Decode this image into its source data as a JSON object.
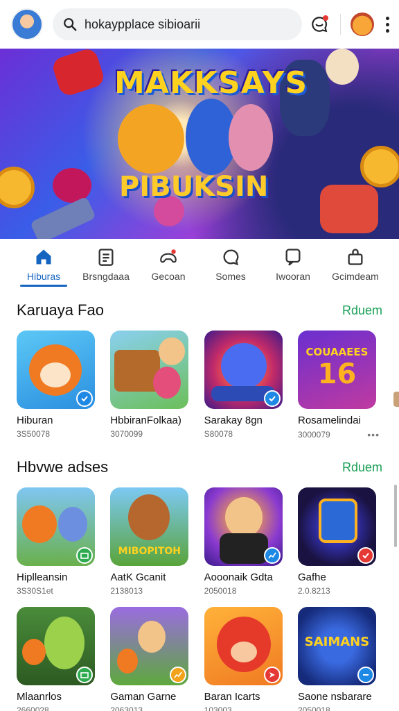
{
  "header": {
    "search_text": "hokaypplace  sibioarii"
  },
  "hero": {
    "title": "MAKKSAYS",
    "subtitle": "PIBUKSIN"
  },
  "tabs": [
    {
      "label": "Hiburas",
      "icon": "home-icon",
      "active": true
    },
    {
      "label": "Brsngdaaa",
      "icon": "clipboard-icon",
      "active": false
    },
    {
      "label": "Gecoan",
      "icon": "controller-icon",
      "active": false
    },
    {
      "label": "Somes",
      "icon": "chat-icon",
      "active": false
    },
    {
      "label": "Iwooran",
      "icon": "message-icon",
      "active": false
    },
    {
      "label": "Gcimdeam",
      "icon": "bag-icon",
      "active": false
    }
  ],
  "sections": [
    {
      "title": "Karuaya Fao",
      "link": "Rduem",
      "cards": [
        {
          "title": "Hiburan",
          "meta": "3S50078",
          "badge_color": "#1e88e5",
          "badge_icon": "check-icon"
        },
        {
          "title": "HbbiranFolkaa)",
          "meta": "3070099",
          "badge_color": "",
          "badge_icon": ""
        },
        {
          "title": "Sarakay 8gn",
          "meta": "S80078",
          "badge_color": "#1e88e5",
          "badge_icon": "check-icon"
        },
        {
          "title": "Rosamelindai",
          "meta": "3000079",
          "badge_color": "",
          "badge_icon": "",
          "more": "•••"
        }
      ]
    },
    {
      "title": "Hbvwe adses",
      "link": "Rduem",
      "cards": [
        {
          "title": "Hiplleansin",
          "meta": "3S30S1et",
          "badge_color": "#2eaa4f",
          "badge_icon": "card-icon"
        },
        {
          "title": "AatK Gcanit",
          "meta": "2138013",
          "badge_color": "",
          "badge_icon": ""
        },
        {
          "title": "Aooonaik Gdta",
          "meta": "2050018",
          "badge_color": "#1e88e5",
          "badge_icon": "chart-icon"
        },
        {
          "title": "Gafhe",
          "meta": "2.0.8213",
          "badge_color": "#e53935",
          "badge_icon": "check-icon"
        }
      ]
    },
    {
      "title": "",
      "link": "",
      "cards": [
        {
          "title": "Mlaanrlos",
          "meta": "2660028",
          "badge_color": "#2eaa4f",
          "badge_icon": "card-icon"
        },
        {
          "title": "Gaman Garne",
          "meta": "2063013",
          "badge_color": "#f2a31b",
          "badge_icon": "chart-icon"
        },
        {
          "title": "Baran Icarts",
          "meta": "103003",
          "badge_color": "#e53935",
          "badge_icon": "send-icon"
        },
        {
          "title": "Saone nsbarare",
          "meta": "2050018",
          "badge_color": "#1e88e5",
          "badge_icon": "minus-icon"
        }
      ]
    }
  ],
  "colors": {
    "accent": "#1565c0",
    "link": "#1aa057"
  }
}
